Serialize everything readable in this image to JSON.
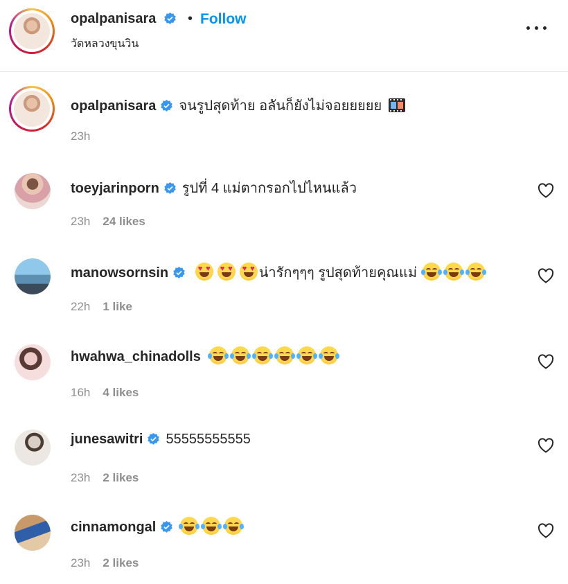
{
  "header": {
    "username": "opalpanisara",
    "separator": "•",
    "follow_label": "Follow",
    "location": "วัดหลวงขุนวิน"
  },
  "caption": {
    "username": "opalpanisara",
    "text": "จนรูปสุดท้าย อลันก็ยังไม่จอยยยยย",
    "time": "23h"
  },
  "comments": [
    {
      "username": "toeyjarinporn",
      "verified": true,
      "text": "รูปที่ 4 แม่ตากรอกไปไหนแล้ว",
      "time": "23h",
      "likes": "24 likes"
    },
    {
      "username": "manowsornsin",
      "verified": true,
      "text": "น่ารักๆๆๆ รูปสุดท้ายคุณแม่",
      "time": "22h",
      "likes": "1 like"
    },
    {
      "username": "hwahwa_chinadolls",
      "verified": false,
      "text": "",
      "time": "16h",
      "likes": "4 likes"
    },
    {
      "username": "junesawitri",
      "verified": true,
      "text": "55555555555",
      "time": "23h",
      "likes": "2 likes"
    },
    {
      "username": "cinnamongal",
      "verified": true,
      "text": "",
      "time": "23h",
      "likes": "2 likes"
    }
  ],
  "icons": {
    "verified": "verified-badge-icon",
    "more": "more-options-icon",
    "like": "heart-outline-icon"
  },
  "colors": {
    "accent": "#0095f6",
    "verified": "#3897f0",
    "text": "#262626",
    "muted": "#8e8e8e"
  }
}
